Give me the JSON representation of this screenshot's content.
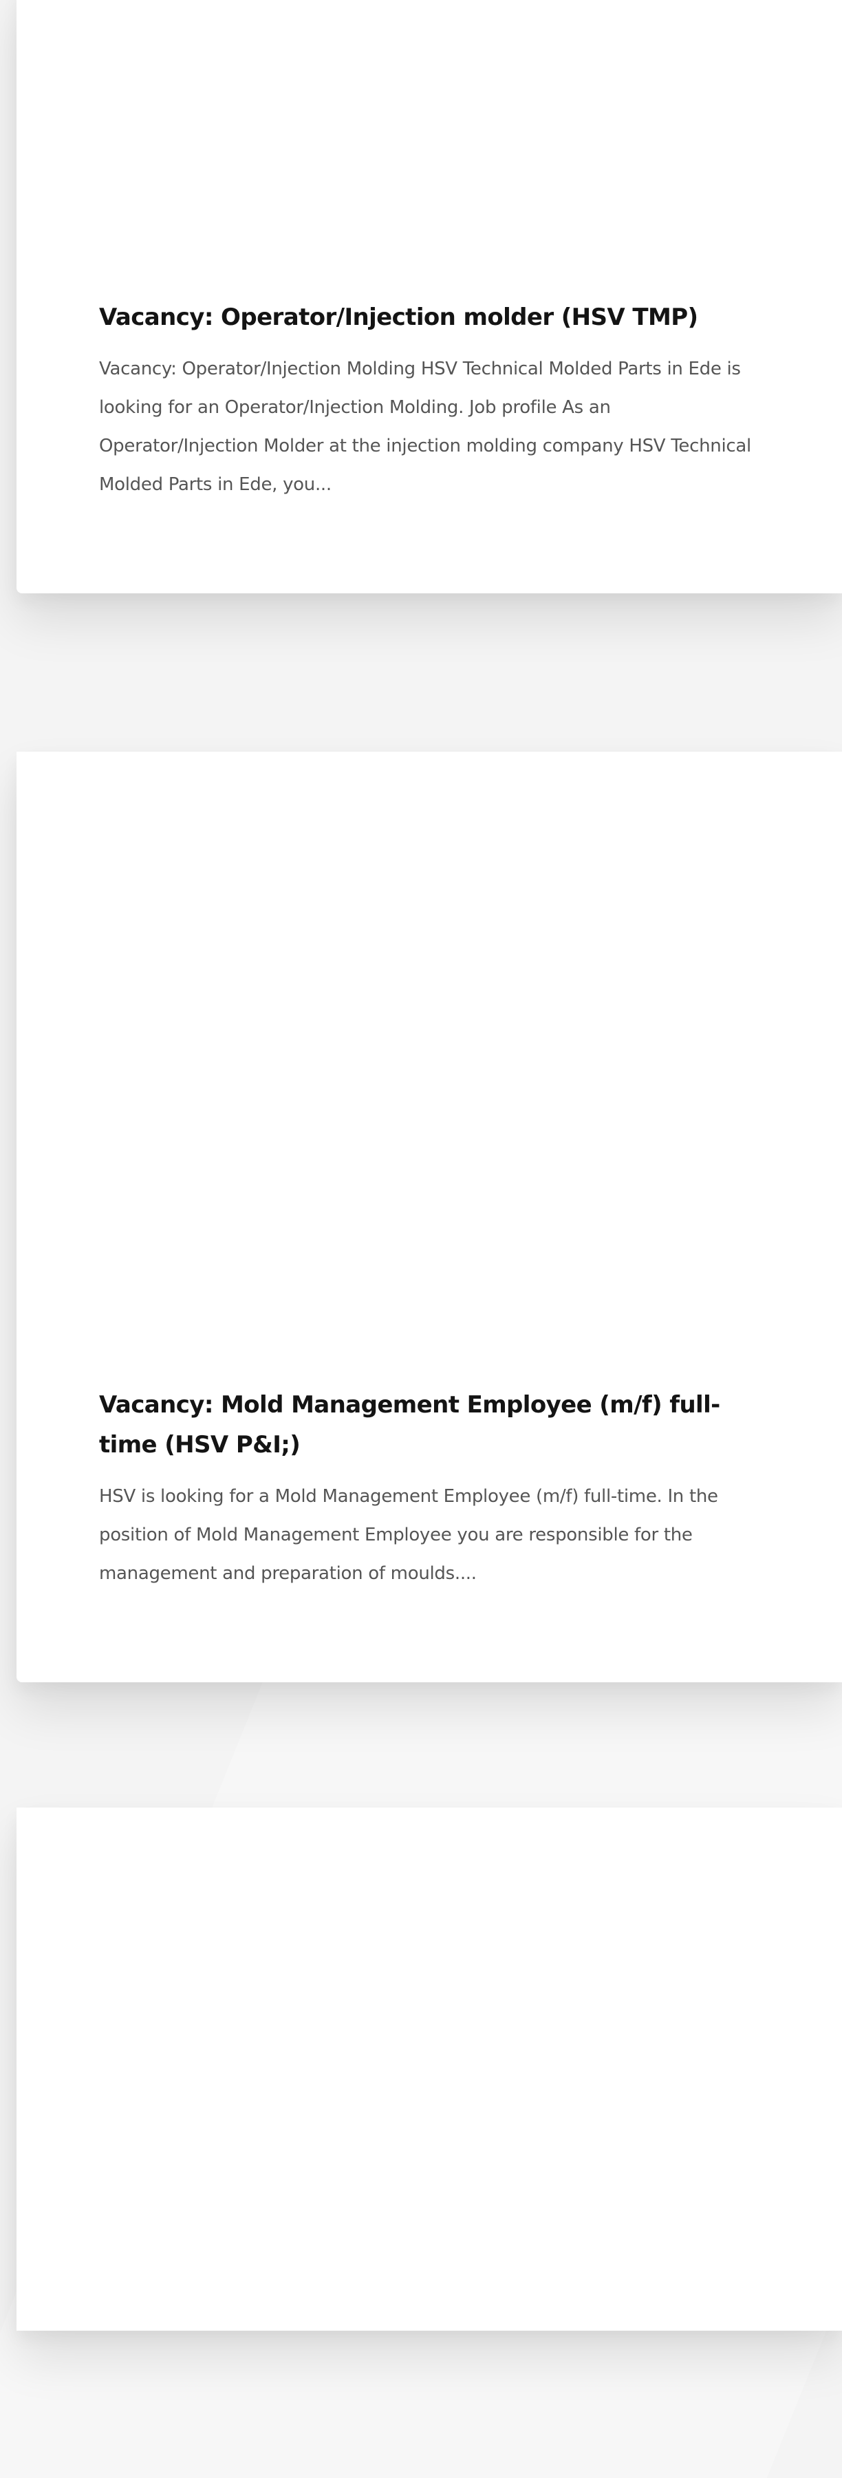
{
  "cards": [
    {
      "title": "Vacancy: Operator/Injection molder (HSV TMP)",
      "excerpt": "Vacancy: Operator/Injection Molding HSV Technical Molded Parts in Ede is looking for an Operator/Injection Molding. Job profile As an Operator/Injection Molder at the injection molding company HSV Technical Molded Parts in Ede, you..."
    },
    {
      "title": "Vacancy: Mold Management Employee (m/f) full-time (HSV P&I;)",
      "excerpt": "HSV is looking for a Mold Management Employee (m/f) full-time. In the position of Mold Management Employee you are responsible for the management and preparation of moulds...."
    },
    {
      "title": "",
      "excerpt": ""
    }
  ]
}
